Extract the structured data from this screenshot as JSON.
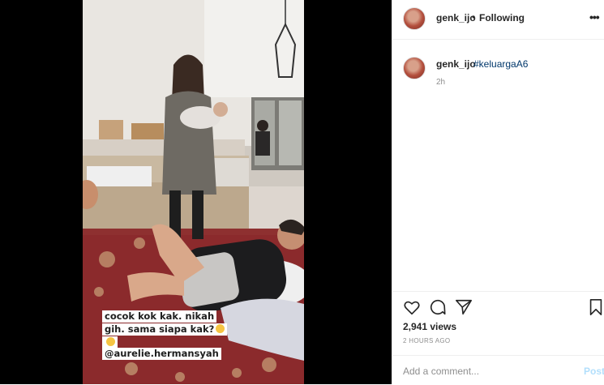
{
  "post": {
    "header": {
      "username": "genk_ijo",
      "separator": "•",
      "follow_status": "Following",
      "more_icon": "more-horizontal-icon"
    },
    "caption": {
      "username": "genk_ijo",
      "text": "#keluargaA6",
      "time_ago": "2h"
    },
    "media": {
      "overlay_lines": [
        "cocok kok kak. nikah",
        "gih. sama siapa kak?"
      ],
      "mention": "@aurelie.hermansyah"
    },
    "actions": {
      "icons": [
        "heart-icon",
        "comment-icon",
        "share-icon",
        "bookmark-icon"
      ]
    },
    "stats": {
      "views": "2,941 views",
      "date": "2 HOURS AGO"
    },
    "comment_box": {
      "placeholder": "Add a comment...",
      "post_label": "Post"
    }
  },
  "colors": {
    "link": "#00376b",
    "muted": "#8e8e8e",
    "post_disabled": "#b2dffc",
    "border": "#efefef"
  }
}
